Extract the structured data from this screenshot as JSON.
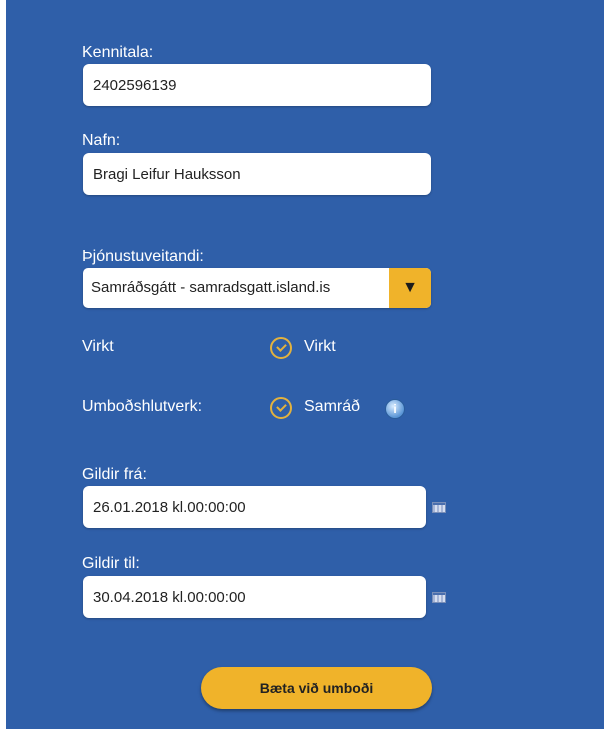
{
  "form": {
    "kennitala": {
      "label": "Kennitala:",
      "value": "2402596139"
    },
    "nafn": {
      "label": "Nafn:",
      "value": "Bragi Leifur Hauksson"
    },
    "thjonustuveitandi": {
      "label": "Þjónustuveitandi:",
      "selected": "Samráðsgátt - samradsgatt.island.is",
      "arrow": "▼"
    },
    "virkt": {
      "label": "Virkt",
      "value_label": "Virkt",
      "checked": true
    },
    "umbodshlutverk": {
      "label": "Umboðshlutverk:",
      "value_label": "Samráð",
      "info_glyph": "i"
    },
    "gildir_fra": {
      "label": "Gildir frá:",
      "value": "26.01.2018 kl.00:00:00"
    },
    "gildir_til": {
      "label": "Gildir til:",
      "value": "30.04.2018 kl.00:00:00"
    },
    "submit_label": "Bæta við umboði"
  },
  "colors": {
    "panel": "#2f5fa9",
    "accent": "#f0b32a",
    "check": "#e3b23e"
  }
}
